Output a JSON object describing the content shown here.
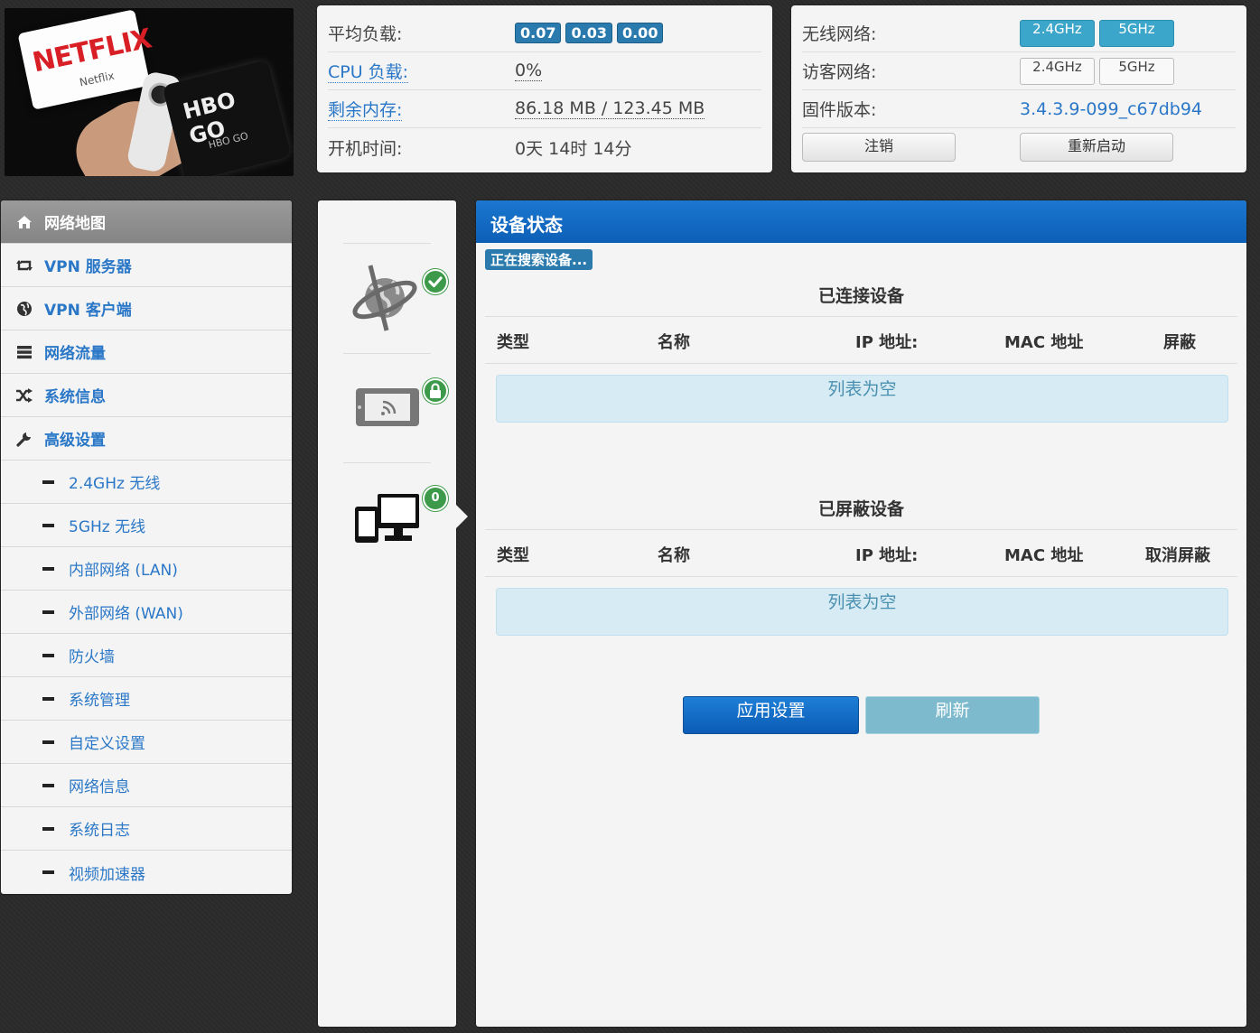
{
  "status": {
    "avg_load_label": "平均负载:",
    "load": [
      "0.07",
      "0.03",
      "0.00"
    ],
    "cpu_label": "CPU 负载:",
    "cpu_value": "0%",
    "mem_label": "剩余内存:",
    "mem_value": "86.18 MB / 123.45 MB",
    "uptime_label": "开机时间:",
    "uptime_value": "0天 14时 14分"
  },
  "wireless": {
    "wireless_label": "无线网络:",
    "guest_label": "访客网络:",
    "band_24": "2.4GHz",
    "band_5": "5GHz",
    "firmware_label": "固件版本:",
    "firmware_value": "3.4.3.9-099_c67db94",
    "logout": "注销",
    "reboot": "重新启动"
  },
  "banner": {
    "netflix": "NETFLIX",
    "netflix_sub": "Netflix",
    "hbo": "HBO GO",
    "hbo_sub": "HBO GO"
  },
  "sidebar": {
    "items": [
      {
        "label": "网络地图",
        "icon": "home-icon"
      },
      {
        "label": "VPN 服务器",
        "icon": "retweet-icon"
      },
      {
        "label": "VPN 客户端",
        "icon": "globe-icon"
      },
      {
        "label": "网络流量",
        "icon": "bars-icon"
      },
      {
        "label": "系统信息",
        "icon": "shuffle-icon"
      },
      {
        "label": "高级设置",
        "icon": "wrench-icon"
      }
    ],
    "subitems": [
      "2.4GHz 无线",
      "5GHz 无线",
      "内部网络 (LAN)",
      "外部网络 (WAN)",
      "防火墙",
      "系统管理",
      "自定义设置",
      "网络信息",
      "系统日志",
      "视频加速器"
    ]
  },
  "devices": {
    "count": "0"
  },
  "main": {
    "title": "设备状态",
    "searching": "正在搜索设备...",
    "connected_title": "已连接设备",
    "blocked_title": "已屏蔽设备",
    "col_type": "类型",
    "col_name": "名称",
    "col_ip": "IP 地址:",
    "col_mac": "MAC 地址",
    "col_block": "屏蔽",
    "col_unblock": "取消屏蔽",
    "empty": "列表为空",
    "apply": "应用设置",
    "refresh": "刷新"
  },
  "colors": {
    "accent": "#2a77c7",
    "header_blue": "#0d5fb6",
    "badge": "#2b7aae",
    "ok_green": "#3c9a4a"
  }
}
